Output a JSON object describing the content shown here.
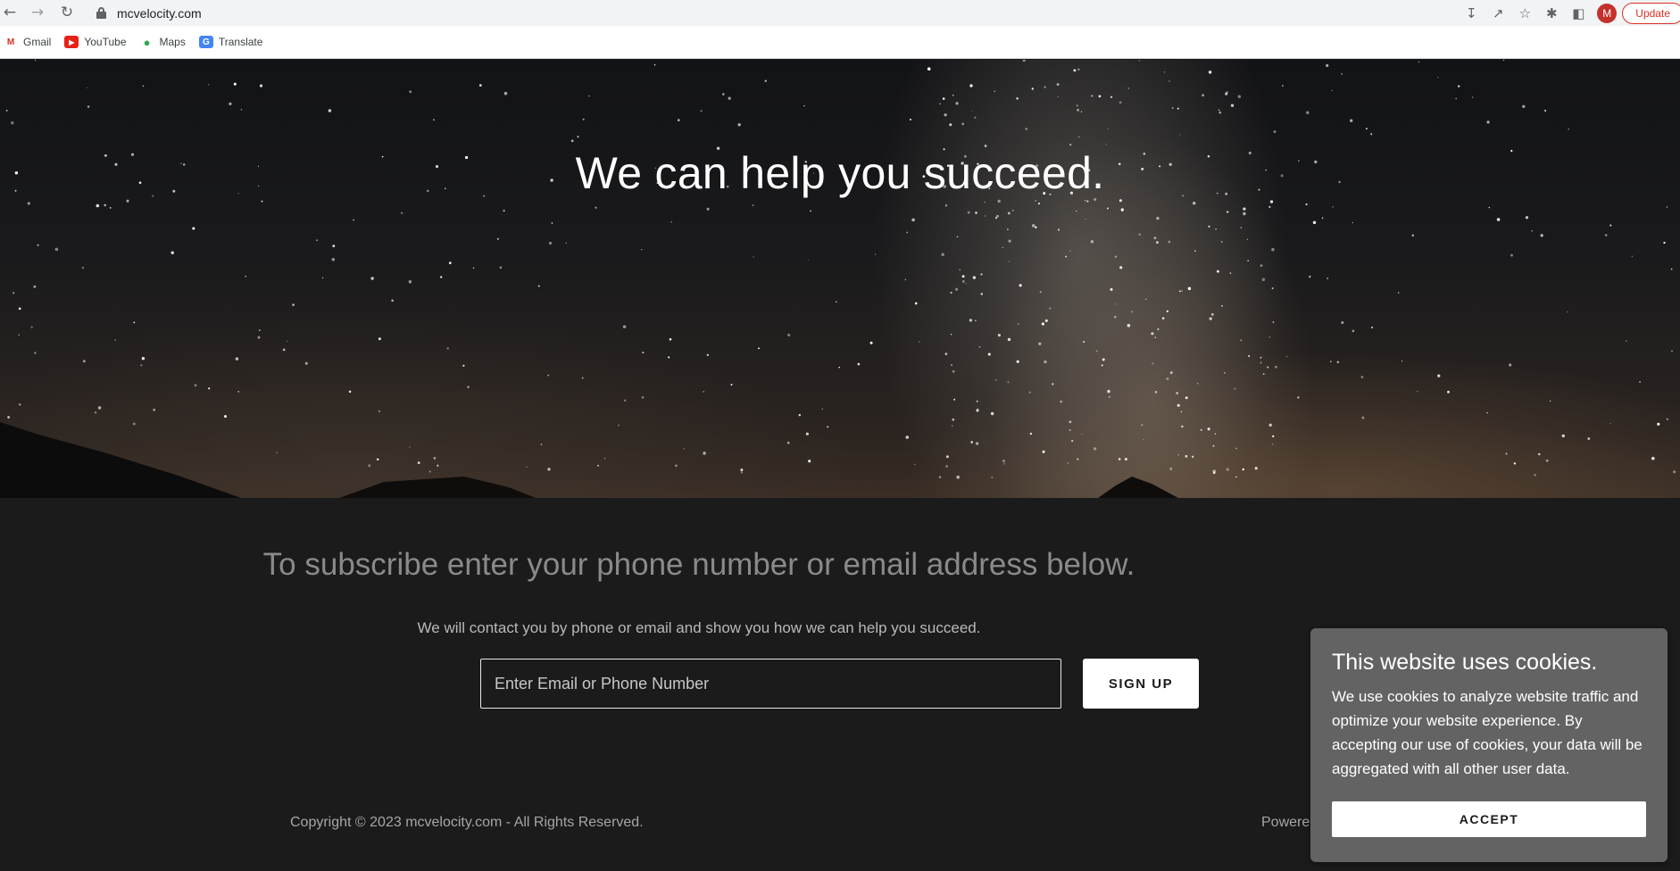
{
  "browser": {
    "url": "mcvelocity.com",
    "profile_initial": "M",
    "update_label": "Update",
    "bookmarks": [
      {
        "label": "Gmail",
        "icon": "gmail-icon"
      },
      {
        "label": "YouTube",
        "icon": "youtube-icon"
      },
      {
        "label": "Maps",
        "icon": "maps-icon"
      },
      {
        "label": "Translate",
        "icon": "translate-icon"
      }
    ]
  },
  "hero": {
    "title": "We can help you succeed."
  },
  "subscribe": {
    "title": "To subscribe enter your phone number or email address below.",
    "description": "We will contact you by phone or email and show you how we can help you succeed.",
    "input_placeholder": "Enter Email or Phone Number",
    "signup_label": "SIGN UP"
  },
  "footer": {
    "copyright": "Copyright © 2023 mcvelocity.com - All Rights Reserved.",
    "powered": "Powered"
  },
  "cookie": {
    "title": "This website uses cookies.",
    "body": "We use cookies to analyze website traffic and optimize your website experience. By accepting our use of cookies, your data will be aggregated with all other user data.",
    "accept_label": "ACCEPT"
  },
  "colors": {
    "page_bg": "#1b1b1b",
    "cookie_bg": "#636363",
    "update_accent": "#d93025"
  }
}
